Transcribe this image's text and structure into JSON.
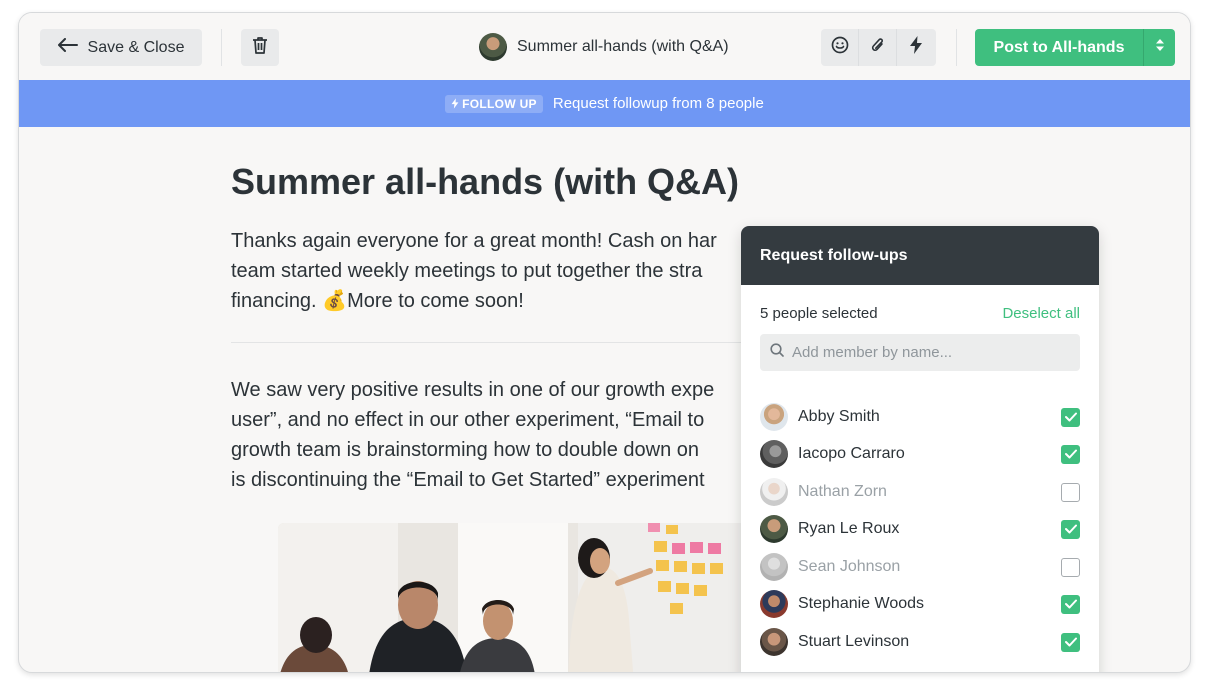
{
  "toolbar": {
    "save_close_label": "Save & Close",
    "doc_title": "Summer all-hands (with Q&A)",
    "post_label": "Post to All-hands",
    "icons": [
      "arrow-left-icon",
      "trash-icon",
      "emoji-icon",
      "paperclip-icon",
      "lightning-icon",
      "sort-caret-icon"
    ]
  },
  "banner": {
    "badge": "FOLLOW UP",
    "text": "Request followup from 8 people"
  },
  "document": {
    "title": "Summer all-hands (with Q&A)",
    "para1": {
      "line1": "Thanks again everyone for a great month! Cash on har",
      "line2": "team started weekly meetings to put together the stra",
      "line3": "financing. 💰More to come soon!"
    },
    "para2": {
      "line1": "We saw very positive results in one of our growth expe",
      "line2": "user”, and no effect in our other experiment, “Email to",
      "line3": "growth team is brainstorming how to double down on",
      "line4": "is discontinuing the “Email to Get Started” experiment"
    }
  },
  "popover": {
    "title": "Request follow-ups",
    "selected_count": "5 people selected",
    "deselect_label": "Deselect all",
    "search_placeholder": "Add member by name...",
    "members": [
      {
        "name": "Abby Smith",
        "checked": true
      },
      {
        "name": "Iacopo Carraro",
        "checked": true
      },
      {
        "name": "Nathan Zorn",
        "checked": false
      },
      {
        "name": "Ryan Le Roux",
        "checked": true
      },
      {
        "name": "Sean Johnson",
        "checked": false
      },
      {
        "name": "Stephanie Woods",
        "checked": true
      },
      {
        "name": "Stuart Levinson",
        "checked": true
      }
    ]
  },
  "colors": {
    "accent_green": "#3fbf7f",
    "banner_blue": "#6f97f4",
    "popover_header": "#343b40"
  }
}
